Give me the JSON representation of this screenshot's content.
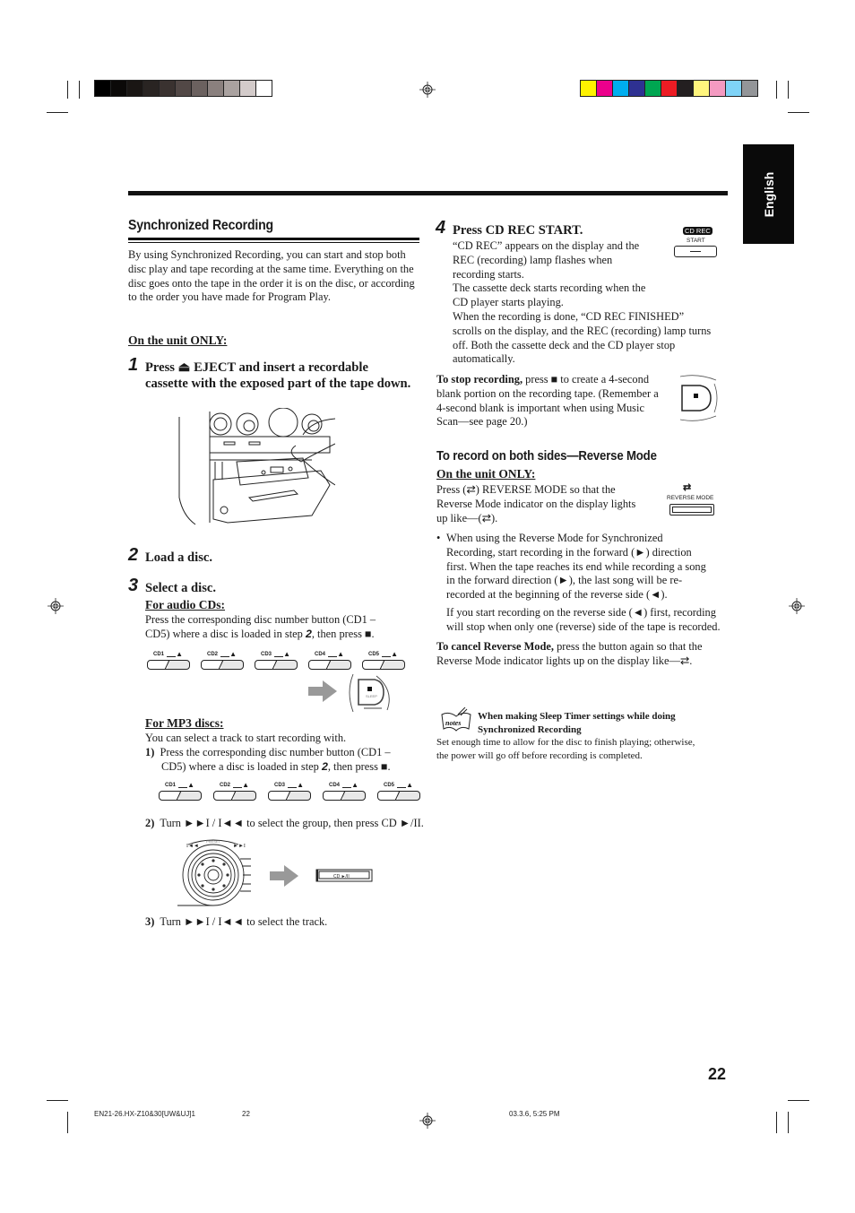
{
  "print_marks": {
    "gray_swatches": [
      "#000000",
      "#0b0908",
      "#1a1614",
      "#292422",
      "#3a3230",
      "#524846",
      "#6b615f",
      "#8a807e",
      "#aaa2a0",
      "#d3cbca",
      "#ffffff"
    ],
    "color_swatches": [
      "#fff200",
      "#ec008c",
      "#00aeef",
      "#2e3192",
      "#00a651",
      "#ed1c24",
      "#231f20",
      "#fff57d",
      "#f49ac1",
      "#7fd3f7",
      "#939598"
    ]
  },
  "language_tab": "English",
  "left": {
    "section_title": "Synchronized Recording",
    "intro": "By using Synchronized Recording, you can start and stop both disc play and tape recording at the same time. Everything on the disc goes onto the tape in the order it is on the disc, or according to the order you have made for Program Play.",
    "unit_only": "On the unit ONLY:",
    "step1": {
      "num": "1",
      "text_a": "Press ",
      "icon": "⏏",
      "text_b": " EJECT and insert a recordable",
      "text_c": "cassette with the exposed part of the tape down."
    },
    "step2": {
      "num": "2",
      "text": "Load a disc."
    },
    "step3": {
      "num": "3",
      "text": "Select a disc."
    },
    "audio_cds": {
      "heading": "For audio CDs:",
      "line1": "Press the corresponding disc number button (CD1 –",
      "line2a": "CD5) where a disc is loaded in step ",
      "line2_step": "2",
      "line2b": ", then press ■."
    },
    "cd_buttons": [
      "CD1",
      "CD2",
      "CD3",
      "CD4",
      "CD5"
    ],
    "mp3": {
      "heading": "For MP3 discs:",
      "intro": "You can select a track to start recording with.",
      "item1_num": "1)",
      "item1_line1": "Press the corresponding disc number button (CD1 –",
      "item1_line2a": "CD5) where a disc is loaded in step ",
      "item1_step": "2",
      "item1_line2b": ", then press ■.",
      "item2_num": "2)",
      "item2_text": "Turn ►►I / I◄◄ to select the group, then press CD ►/II.",
      "item3_num": "3)",
      "item3_text": "Turn ►►I / I◄◄ to select the track."
    },
    "illustration_labels": {
      "stop_button": "■",
      "sleep": "SLEEP",
      "preset": "PRESET",
      "cd_play_pause": "CD ►/II"
    }
  },
  "right": {
    "step4": {
      "num": "4",
      "title": "Press CD REC START.",
      "lines": [
        "“CD REC” appears on the display and the",
        "REC (recording) lamp flashes when",
        "recording starts.",
        "The cassette deck starts recording when the",
        "CD player starts playing.",
        "When the recording is done, “CD REC FINISHED”",
        "scrolls on the display, and the REC (recording) lamp turns",
        "off. Both the cassette deck and the CD player stop",
        "automatically."
      ],
      "button_label_top": "CD REC",
      "button_label_bottom": "START"
    },
    "stop": {
      "lead": "To stop recording,",
      "lines": [
        " press ■ to create a 4-second",
        "blank portion on the recording tape. (Remember a",
        "4-second blank is important when using Music",
        "Scan—see page 20.)"
      ]
    },
    "reverse": {
      "title": "To record on both sides—Reverse Mode",
      "unit_only": "On the unit ONLY:",
      "lines": [
        "Press (⇄) REVERSE MODE so that the",
        "Reverse Mode indicator on the display lights",
        "up like—(⇄)."
      ],
      "button_label": "REVERSE MODE",
      "bullet_lines": [
        "When using the Reverse Mode for Synchronized",
        "Recording, start recording in the forward (►) direction",
        "first. When the tape reaches its end while recording a song",
        "in the forward direction (►), the last song will be re-",
        "recorded at the beginning of the reverse side (◄)."
      ],
      "bullet_extra": [
        "If you start recording on the reverse side (◄) first, recording",
        "will stop when only one (reverse) side of the tape is recorded."
      ],
      "cancel_lead": "To cancel Reverse Mode,",
      "cancel_line1": " press the button again so that the",
      "cancel_line2": "Reverse Mode indicator lights up on the display like—⇄."
    },
    "notes": {
      "icon_label": "notes",
      "title_line1": "When making Sleep Timer settings while doing",
      "title_line2": "Synchronized Recording",
      "body_line1": "Set enough time to allow for the disc to finish playing; otherwise,",
      "body_line2": "the power will go off before recording is completed."
    }
  },
  "page_number": "22",
  "footer": {
    "file": "EN21-26.HX-Z10&30[UW&UJ]1",
    "page": "22",
    "timestamp": "03.3.6, 5:25 PM"
  }
}
